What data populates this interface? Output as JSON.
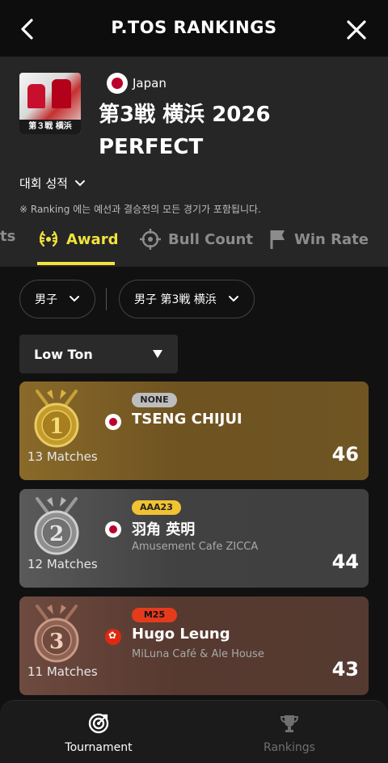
{
  "header": {
    "title": "P.TOS RANKINGS"
  },
  "event": {
    "thumb_caption": "第３戦 横浜",
    "country": "Japan",
    "name": "第3戦 横浜 2026 PERFECT",
    "results_label": "대회 성적",
    "note": "※ Ranking 에는 예선과 결승전의 모든 경기가 포함됩니다."
  },
  "tabs": [
    {
      "label": "ts",
      "icon": "truncated-tab"
    },
    {
      "label": "Award",
      "icon": "laurel-icon",
      "active": true
    },
    {
      "label": "Bull Count",
      "icon": "crosshair-icon"
    },
    {
      "label": "Win Rate",
      "icon": "flag-icon"
    }
  ],
  "filters": {
    "gender": "男子",
    "event": "男子 第3戦 横浜",
    "award_type": "Low Ton"
  },
  "rankings": [
    {
      "rank": 1,
      "badge": "NONE",
      "name": "TSENG CHIJUI",
      "affiliation": "",
      "country": "Japan",
      "matches": "13 Matches",
      "score": "46"
    },
    {
      "rank": 2,
      "badge": "AAA23",
      "name": "羽角 英明",
      "affiliation": "Amusement Cafe ZICCA",
      "country": "Japan",
      "matches": "12 Matches",
      "score": "44"
    },
    {
      "rank": 3,
      "badge": "M25",
      "name": "Hugo Leung",
      "affiliation": "MiLuna Café & Ale House",
      "country": "Hong Kong",
      "matches": "11 Matches",
      "score": "43"
    }
  ],
  "bottom_nav": [
    {
      "label": "Tournament",
      "icon": "dartboard-icon",
      "active": true
    },
    {
      "label": "Rankings",
      "icon": "trophy-icon",
      "active": false
    }
  ],
  "colors": {
    "accent": "#f2e33c",
    "gold_card": "#7a5d25",
    "silver_card": "#4a4a4a",
    "bronze_card": "#5f4036"
  }
}
